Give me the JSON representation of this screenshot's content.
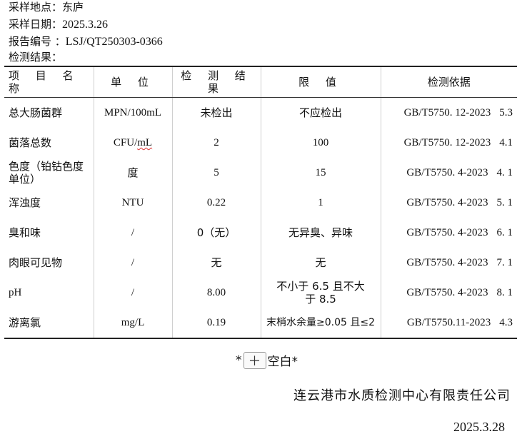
{
  "meta": {
    "location_label": "采样地点：",
    "location_value": "东庐",
    "date_label": "采样日期：",
    "date_value": "2025.3.26",
    "report_label": "报告编号 ：",
    "report_value": "LSJ/QT250303-0366",
    "results_label": "检测结果："
  },
  "table": {
    "headers": {
      "item": "项 目 名 称",
      "unit": "单  位",
      "result": "检 测 结 果",
      "limit": "限    值",
      "basis": "检测依据"
    },
    "rows": [
      {
        "item": "总大肠菌群",
        "unit": "MPN/100mL",
        "result": "未检出",
        "limit": "不应检出",
        "basis": "GB/T5750. 12-2023",
        "section": "5.3"
      },
      {
        "item": "菌落总数",
        "unit_main": "CFU/",
        "unit_tail": "mL",
        "result": "2",
        "limit": "100",
        "basis": "GB/T5750. 12-2023",
        "section": "4.1"
      },
      {
        "item": "色度（铂钴色度单位）",
        "unit": "度",
        "result": "5",
        "limit": "15",
        "basis": "GB/T5750. 4-2023",
        "section": "4. 1"
      },
      {
        "item": "浑浊度",
        "unit": "NTU",
        "result": "0.22",
        "limit": "1",
        "basis": "GB/T5750. 4-2023",
        "section": "5. 1"
      },
      {
        "item": "臭和味",
        "unit": "/",
        "result": "0（无）",
        "limit": "无异臭、异味",
        "basis": "GB/T5750. 4-2023",
        "section": "6. 1"
      },
      {
        "item": "肉眼可见物",
        "unit": "/",
        "result": "无",
        "limit": "无",
        "basis": "GB/T5750. 4-2023",
        "section": "7. 1"
      },
      {
        "item": "pH",
        "unit": "/",
        "result": "8.00",
        "limit": "不小于 6.5 且不大于 8.5",
        "basis": "GB/T5750. 4-2023",
        "section": "8. 1"
      },
      {
        "item": "游离氯",
        "unit": "mg/L",
        "result": "0.19",
        "limit": "末梢水余量≥0.05 且≤2",
        "basis": "GB/T5750.11-2023",
        "section": "4.3"
      }
    ]
  },
  "blank_note": {
    "prefix": "*",
    "button": "＋",
    "suffix": "空白*"
  },
  "organization": "连云港市水质检测中心有限责任公司",
  "sign_date": "2025.3.28"
}
